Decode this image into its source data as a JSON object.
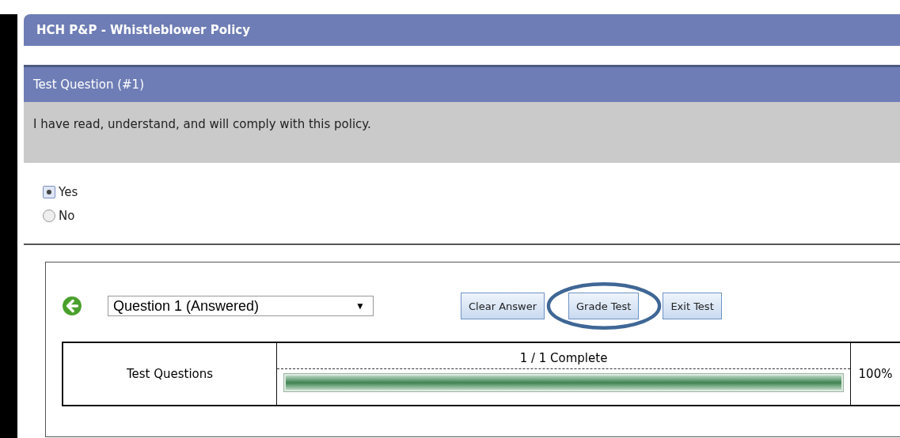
{
  "course": {
    "title": "HCH P&P - Whistleblower Policy"
  },
  "question": {
    "title": "Test Question (#1)",
    "text": "I have read, understand, and will comply with this policy."
  },
  "options": [
    {
      "label": "Yes",
      "selected": true
    },
    {
      "label": "No",
      "selected": false
    }
  ],
  "navigator": {
    "selected_question": "Question 1 (Answered)",
    "caret": "▼"
  },
  "buttons": [
    {
      "label": "Clear Answer"
    },
    {
      "label": "Grade Test"
    },
    {
      "label": "Exit Test"
    }
  ],
  "progress": {
    "label": "Test Questions",
    "status": "1 / 1 Complete",
    "level": 1,
    "percent": "100%"
  }
}
